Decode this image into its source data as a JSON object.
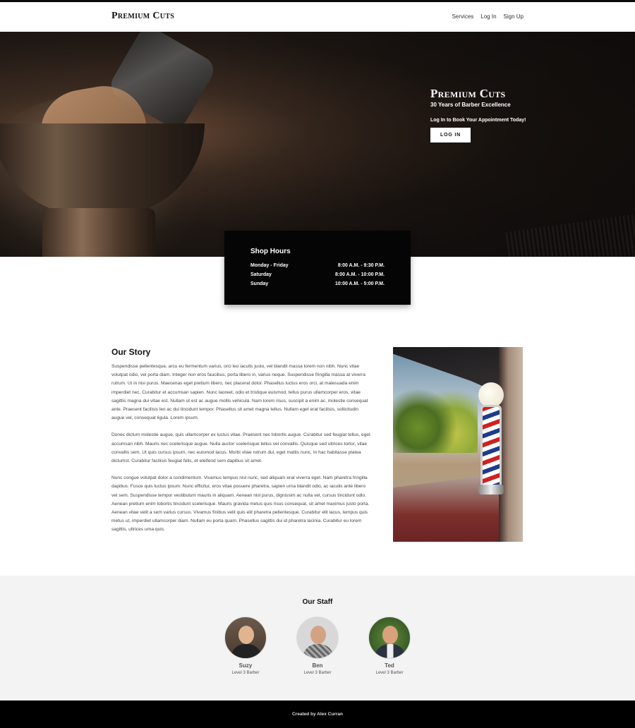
{
  "header": {
    "brand": "Premium Cuts",
    "nav": [
      "Services",
      "Log In",
      "Sign Up"
    ]
  },
  "hero": {
    "title": "Premium Cuts",
    "subtitle": "30 Years of Barber Excellence",
    "cta_text": "Log In to Book Your Appointment Today!",
    "button_label": "LOG IN"
  },
  "hours": {
    "title": "Shop Hours",
    "rows": [
      {
        "day": "Monday - Friday",
        "time": "8:00 A.M. - 9:30 P.M."
      },
      {
        "day": "Saturday",
        "time": "8:00 A.M. - 10:00 P.M."
      },
      {
        "day": "Sunday",
        "time": "10:00 A.M. - 5:00 P.M."
      }
    ]
  },
  "story": {
    "title": "Our Story",
    "paragraphs": [
      "Suspendisse pellentesque, arcu eu fermentum varius, orci leo iaculis justo, vel blandit massa lorem non nibh. Nunc vitae volutpat odio, vel porta diam. Integer non eros faucibus, porta libero in, varius neque. Suspendisse fringilla massa at viverra rutrum. Ut in nisi purus. Maecenas eget pretium libero, nec placerat dolor. Phasellus luctus eros orci, at malesuada enim imperdiet nec. Curabitur et accumsan sapien. Nunc laoreet, odio et tristique euismod, tellus purus ullamcorper eros, vitae sagittis magna dui vitae est. Nullam ut est ac augue mollis vehicula. Nam lorem risus, suscipit a enim ac, molestie consequat ante. Praesent facilisis leo ac dui tincidunt tempor. Phasellus sit amet magna tellus. Nullam eget erat facilisis, sollicitudin augue vel, consequat ligula. Lorem ipsum.",
      "Donec dictum molestie augue, quis ullamcorper ex luctus vitae. Praesent nec lobortis augue. Curabitur sed feugiat tellus, eget accumsan nibh. Mauris nec scelerisque augue. Nulla auctor scelerisque tellus vel convallis. Quisque sed ultrices tortor, vitae convallis sem. Ut quis cursus ipsum, nec euismod lacus. Morbi vitae rutrum dui, eget mattis nunc. In hac habitasse platea dictumst. Curabitur facilisis feugiat felis, et eleifend sem dapibus sit amet.",
      "Nunc congue volutpat dolor a condimentum. Vivamus tempus nisl nunc, sed aliquam erat viverra eget. Nam pharetra fringilla dapibus. Fusce quis luctus ipsum. Nunc efficitur, eros vitae posuere pharetra, sapien urna blandit odio, ac iaculis ante libero vel sem. Suspendisse tempor vestibulum mauris in aliquam. Aenean nisl purus, dignissim ac nulla vel, cursus tincidunt odio. Aenean pretium enim lobortis tincidunt scelerisque. Mauris gravida metus quis risus consequat, sit amet maximus justo porta. Aenean vitae velit a sem varius cursus. Vivamus finibus velit quis elit pharetra pellentesque. Curabitur elit lacus, tempus quis metus ut, imperdiet ullamcorper diam. Nullam eu porta quam. Phasellus sagittis dui id pharetra lacinia. Curabitur eu lorem sagittis, ultrices urna quis."
    ]
  },
  "staff": {
    "title": "Our Staff",
    "members": [
      {
        "name": "Suzy",
        "role": "Level 3 Barber"
      },
      {
        "name": "Ben",
        "role": "Level 3 Barber"
      },
      {
        "name": "Ted",
        "role": "Level 3 Barber"
      }
    ]
  },
  "footer": {
    "credit": "Created by Alex Curran"
  }
}
